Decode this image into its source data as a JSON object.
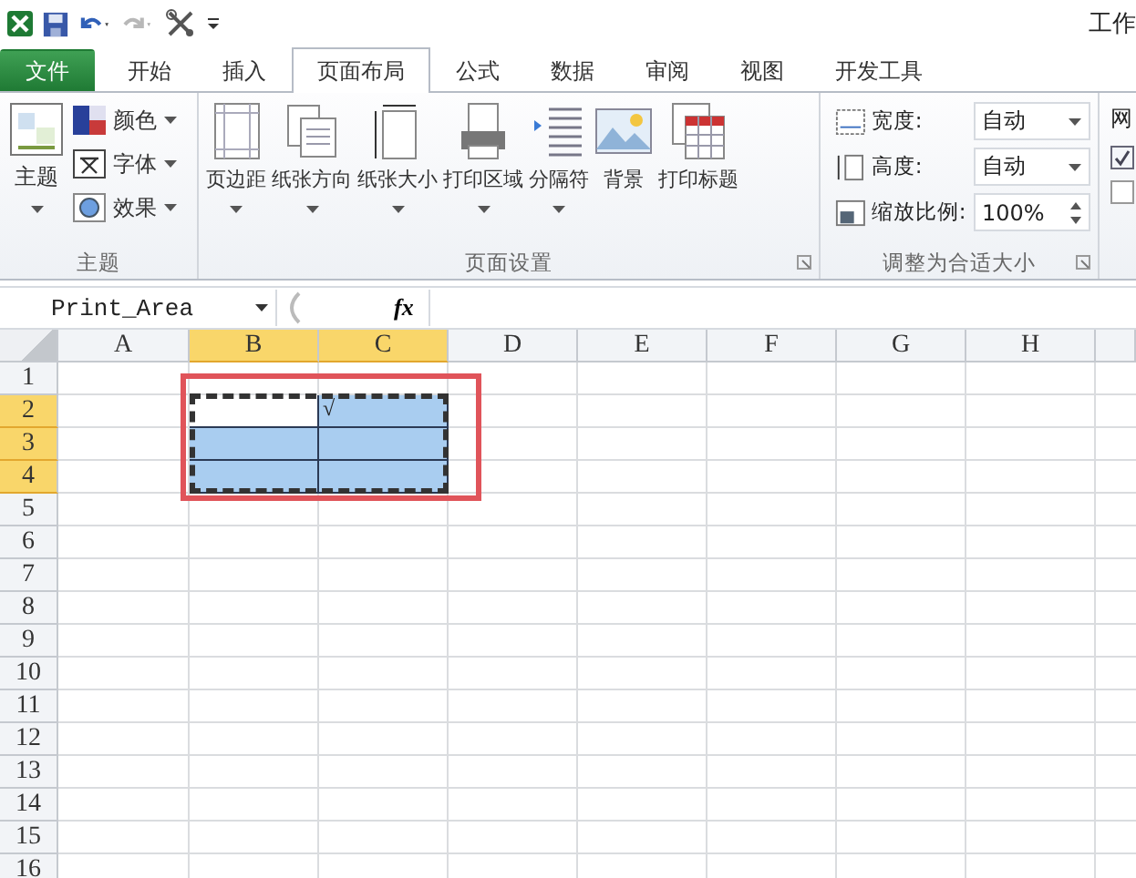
{
  "window": {
    "title": "工作"
  },
  "tabs": [
    {
      "label": "文件",
      "kind": "file",
      "selected": false
    },
    {
      "label": "开始",
      "kind": "tab",
      "selected": false
    },
    {
      "label": "插入",
      "kind": "tab",
      "selected": false
    },
    {
      "label": "页面布局",
      "kind": "tab",
      "selected": true
    },
    {
      "label": "公式",
      "kind": "tab",
      "selected": false
    },
    {
      "label": "数据",
      "kind": "tab",
      "selected": false
    },
    {
      "label": "审阅",
      "kind": "tab",
      "selected": false
    },
    {
      "label": "视图",
      "kind": "tab",
      "selected": false
    },
    {
      "label": "开发工具",
      "kind": "tab",
      "selected": false
    }
  ],
  "theme_group": {
    "label": "主题",
    "main": {
      "label": "主题"
    },
    "items": [
      {
        "label": "颜色"
      },
      {
        "label": "字体"
      },
      {
        "label": "效果"
      }
    ]
  },
  "page_setup_group": {
    "label": "页面设置",
    "buttons": [
      {
        "label": "页边距",
        "has_menu": true
      },
      {
        "label": "纸张方向",
        "has_menu": true
      },
      {
        "label": "纸张大小",
        "has_menu": true
      },
      {
        "label": "打印区域",
        "has_menu": true
      },
      {
        "label": "分隔符",
        "has_menu": true
      },
      {
        "label": "背景",
        "has_menu": false
      },
      {
        "label": "打印标题",
        "has_menu": false
      }
    ]
  },
  "scale_group": {
    "label": "调整为合适大小",
    "fields": [
      {
        "label": "宽度:",
        "value": "自动",
        "kind": "dropdown"
      },
      {
        "label": "高度:",
        "value": "自动",
        "kind": "dropdown"
      },
      {
        "label": "缩放比例:",
        "value": "100%",
        "kind": "spinner"
      }
    ]
  },
  "sheet_options_group": {
    "label": "网",
    "checkboxes": [
      {
        "checked": true
      },
      {
        "checked": false
      }
    ]
  },
  "formula_bar": {
    "name_box": "Print_Area",
    "function_button": "fx"
  },
  "sheet": {
    "columns": [
      {
        "label": "A",
        "selected": false
      },
      {
        "label": "B",
        "selected": true
      },
      {
        "label": "C",
        "selected": true
      },
      {
        "label": "D",
        "selected": false
      },
      {
        "label": "E",
        "selected": false
      },
      {
        "label": "F",
        "selected": false
      },
      {
        "label": "G",
        "selected": false
      },
      {
        "label": "H",
        "selected": false
      }
    ],
    "rows": [
      {
        "label": "1",
        "selected": false
      },
      {
        "label": "2",
        "selected": true,
        "cells": [
          {
            "selected": false,
            "active": false
          },
          {
            "active": true
          },
          {
            "selected": true,
            "active": false,
            "value": "√"
          }
        ]
      },
      {
        "label": "3",
        "selected": true,
        "cells": [
          {
            "selected": false,
            "active": false
          },
          {
            "selected": true,
            "active": false
          },
          {
            "selected": true,
            "active": false
          }
        ]
      },
      {
        "label": "4",
        "selected": true,
        "cells": [
          {
            "selected": false,
            "active": false
          },
          {
            "selected": true,
            "active": false
          },
          {
            "selected": true,
            "active": false
          }
        ]
      },
      {
        "label": "5",
        "selected": false
      },
      {
        "label": "6",
        "selected": false
      },
      {
        "label": "7",
        "selected": false
      },
      {
        "label": "8",
        "selected": false
      },
      {
        "label": "9",
        "selected": false
      },
      {
        "label": "10",
        "selected": false
      },
      {
        "label": "11",
        "selected": false
      },
      {
        "label": "12",
        "selected": false
      },
      {
        "label": "13",
        "selected": false
      },
      {
        "label": "14",
        "selected": false
      },
      {
        "label": "15",
        "selected": false
      },
      {
        "label": "16",
        "selected": false
      }
    ]
  }
}
